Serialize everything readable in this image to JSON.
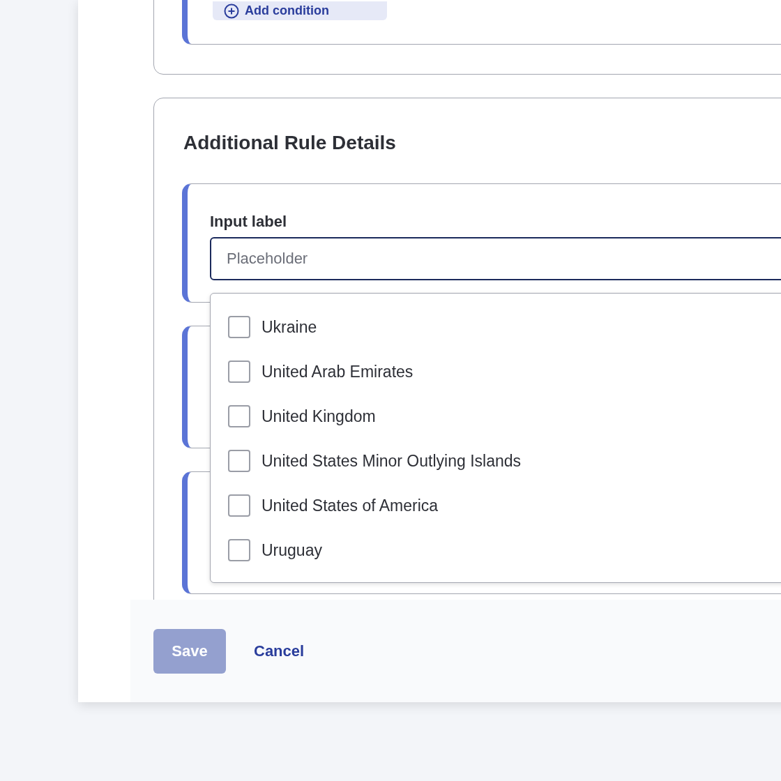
{
  "top_card": {
    "button": "Add condition"
  },
  "details_card": {
    "title": "Additional Rule Details",
    "field": {
      "label": "Input label",
      "placeholder": "Placeholder"
    },
    "dropdown": {
      "options": [
        {
          "label": "Ukraine",
          "checked": false
        },
        {
          "label": "United Arab Emirates",
          "checked": false
        },
        {
          "label": "United Kingdom",
          "checked": false
        },
        {
          "label": "United States Minor Outlying Islands",
          "checked": false
        },
        {
          "label": "United States of America",
          "checked": false
        },
        {
          "label": "Uruguay",
          "checked": false
        }
      ]
    }
  },
  "footer": {
    "save": {
      "label": "Save",
      "disabled": true
    },
    "cancel": "Cancel"
  }
}
